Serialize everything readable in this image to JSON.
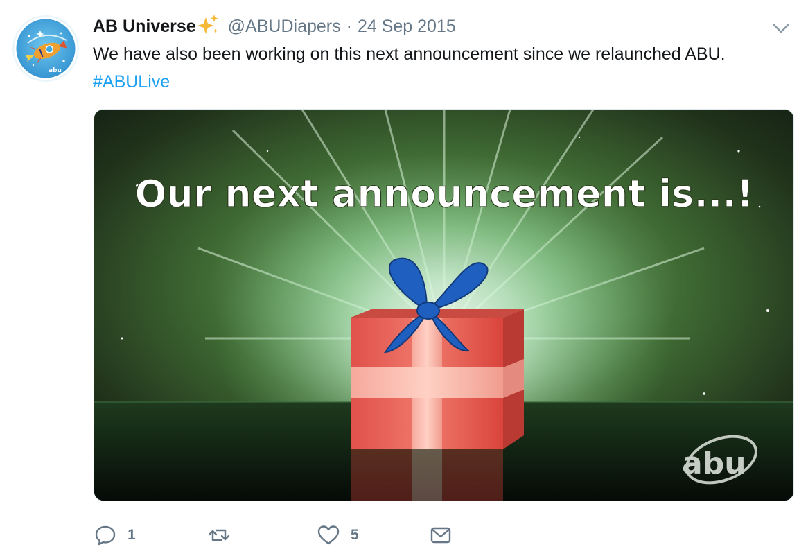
{
  "tweet": {
    "display_name": "AB Universe",
    "handle": "@ABUDiapers",
    "separator": "·",
    "timestamp": "24 Sep 2015",
    "text": "We have also been working on this next announcement since we relaunched ABU.",
    "hashtag": "#ABULive"
  },
  "media": {
    "headline": "Our next announcement is...!",
    "watermark": "abu"
  },
  "actions": {
    "reply_count": "1",
    "retweet_count": "",
    "like_count": "5"
  },
  "icons": {
    "avatar": "abu-rocket-avatar",
    "verified_emoji": "sparkles-icon",
    "more": "chevron-down-icon",
    "reply": "reply-icon",
    "retweet": "retweet-icon",
    "like": "heart-icon",
    "dm": "envelope-icon"
  },
  "colors": {
    "text": "#14171a",
    "muted": "#657786",
    "link": "#1da1f2",
    "gift_red": "#d9443c",
    "ribbon_blue": "#1f5fbf",
    "glow_green": "#8fd48f"
  }
}
